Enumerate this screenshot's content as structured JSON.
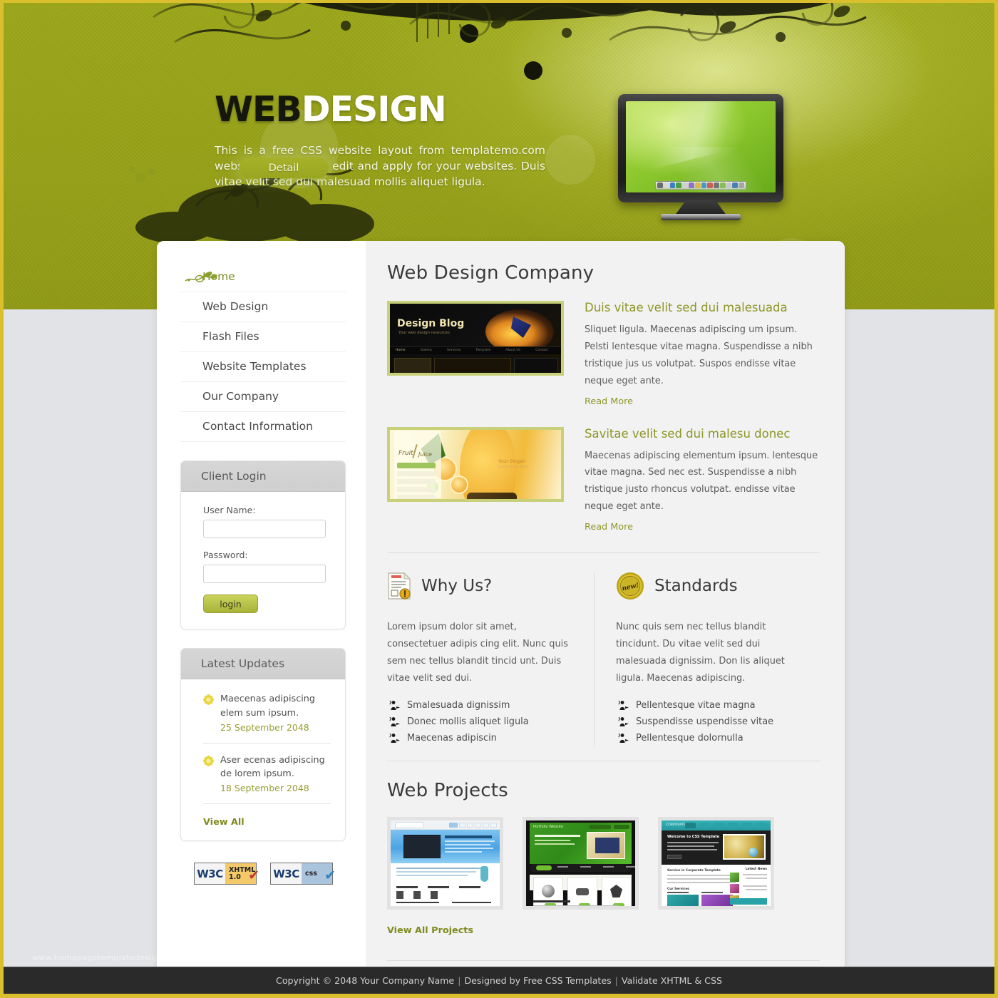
{
  "header": {
    "logo_bold": "WEB",
    "logo_light": "DESIGN",
    "description": "This is a free CSS website layout from templatemo.com website. Feel free to edit and apply for your websites. Duis vitae velit sed dui malesuad mollis aliquet ligula.",
    "detail_button": "Detail",
    "monitor_icon": "computer-monitor"
  },
  "sidebar": {
    "nav": [
      {
        "label": "Home",
        "active": true,
        "icon": "leaf-swirl-icon"
      },
      {
        "label": "Web Design",
        "active": false
      },
      {
        "label": "Flash Files",
        "active": false
      },
      {
        "label": "Website Templates",
        "active": false
      },
      {
        "label": "Our Company",
        "active": false
      },
      {
        "label": "Contact Information",
        "active": false
      }
    ],
    "login": {
      "title": "Client Login",
      "username_label": "User Name:",
      "username_value": "",
      "username_placeholder": "",
      "password_label": "Password:",
      "password_value": "",
      "password_placeholder": "",
      "button": "login"
    },
    "updates": {
      "title": "Latest Updates",
      "items": [
        {
          "text": "Maecenas adipiscing elem sum ipsum.",
          "date": "25 September 2048",
          "icon": "flower-icon"
        },
        {
          "text": "Aser ecenas adipiscing de lorem ipsum.",
          "date": "18 September 2048",
          "icon": "flower-icon"
        }
      ],
      "view_all": "View All"
    },
    "badges": [
      {
        "left": "W3C",
        "line1": "XHTML",
        "line2": "1.0",
        "check": "✔",
        "name": "w3c-xhtml-badge"
      },
      {
        "left": "W3C",
        "line1": "css",
        "line2": "",
        "check": "✔",
        "name": "w3c-css-badge"
      }
    ]
  },
  "main": {
    "heading": "Web Design Company",
    "articles": [
      {
        "title": "Duis vitae velit sed dui malesuada",
        "text": "Sliquet ligula. Maecenas adipiscing um ipsum. Pelsti lentesque vitae magna. Suspendisse a nibh tristique jus us volutpat. Suspos endisse vitae neque eget ante.",
        "read_more": "Read More",
        "thumb_label": "Design Blog",
        "thumb_sub": "Your web design resources"
      },
      {
        "title": "Savitae velit sed dui malesu donec",
        "text": "Maecenas adipiscing elementum ipsum. lentesque vitae magna. Sed nec est. Suspendisse a nibh tristique justo rhoncus volutpat. endisse vitae neque eget ante.",
        "read_more": "Read More",
        "thumb_label": "Fruit Juice",
        "thumb_sub": "Your Slogan"
      }
    ],
    "columns": [
      {
        "title": "Why Us?",
        "icon": "document-alert-icon",
        "text": "Lorem ipsum dolor sit amet, consectetuer adipis cing elit. Nunc quis sem nec tellus blandit tincid unt. Duis vitae velit sed dui.",
        "bullets": [
          "Smalesuada dignissim",
          "Donec mollis aliquet ligula",
          "Maecenas adipiscin"
        ]
      },
      {
        "title": "Standards",
        "icon": "new-seal-icon",
        "icon_text": "new!",
        "text": "Nunc quis sem nec tellus blandit tincidunt. Du vitae velit sed dui malesuada dignissim. Don lis aliquet ligula. Maecenas adipiscing.",
        "bullets": [
          "Pellentesque vitae magna",
          "Suspendisse uspendisse vitae",
          "Pellentesque dolornulla"
        ]
      }
    ],
    "projects_heading": "Web Projects",
    "projects": [
      {
        "name": "project-thumb-blue"
      },
      {
        "name": "project-thumb-green"
      },
      {
        "name": "project-thumb-teal"
      }
    ],
    "view_all_projects": "View All Projects"
  },
  "watermark": "www.homepagetemplatedesign.com",
  "footer": {
    "copyright": "Copyright © 2048 Your Company Name",
    "designed_by": "Designed by Free CSS Templates",
    "validate": "Validate XHTML & CSS",
    "separator": "|"
  },
  "colors": {
    "header_green": "#96a018",
    "border_gold": "#d9bf2e",
    "accent_olive": "#8d9626",
    "body_gray": "#e2e3e6",
    "footer_dark": "#2a2a2a"
  }
}
